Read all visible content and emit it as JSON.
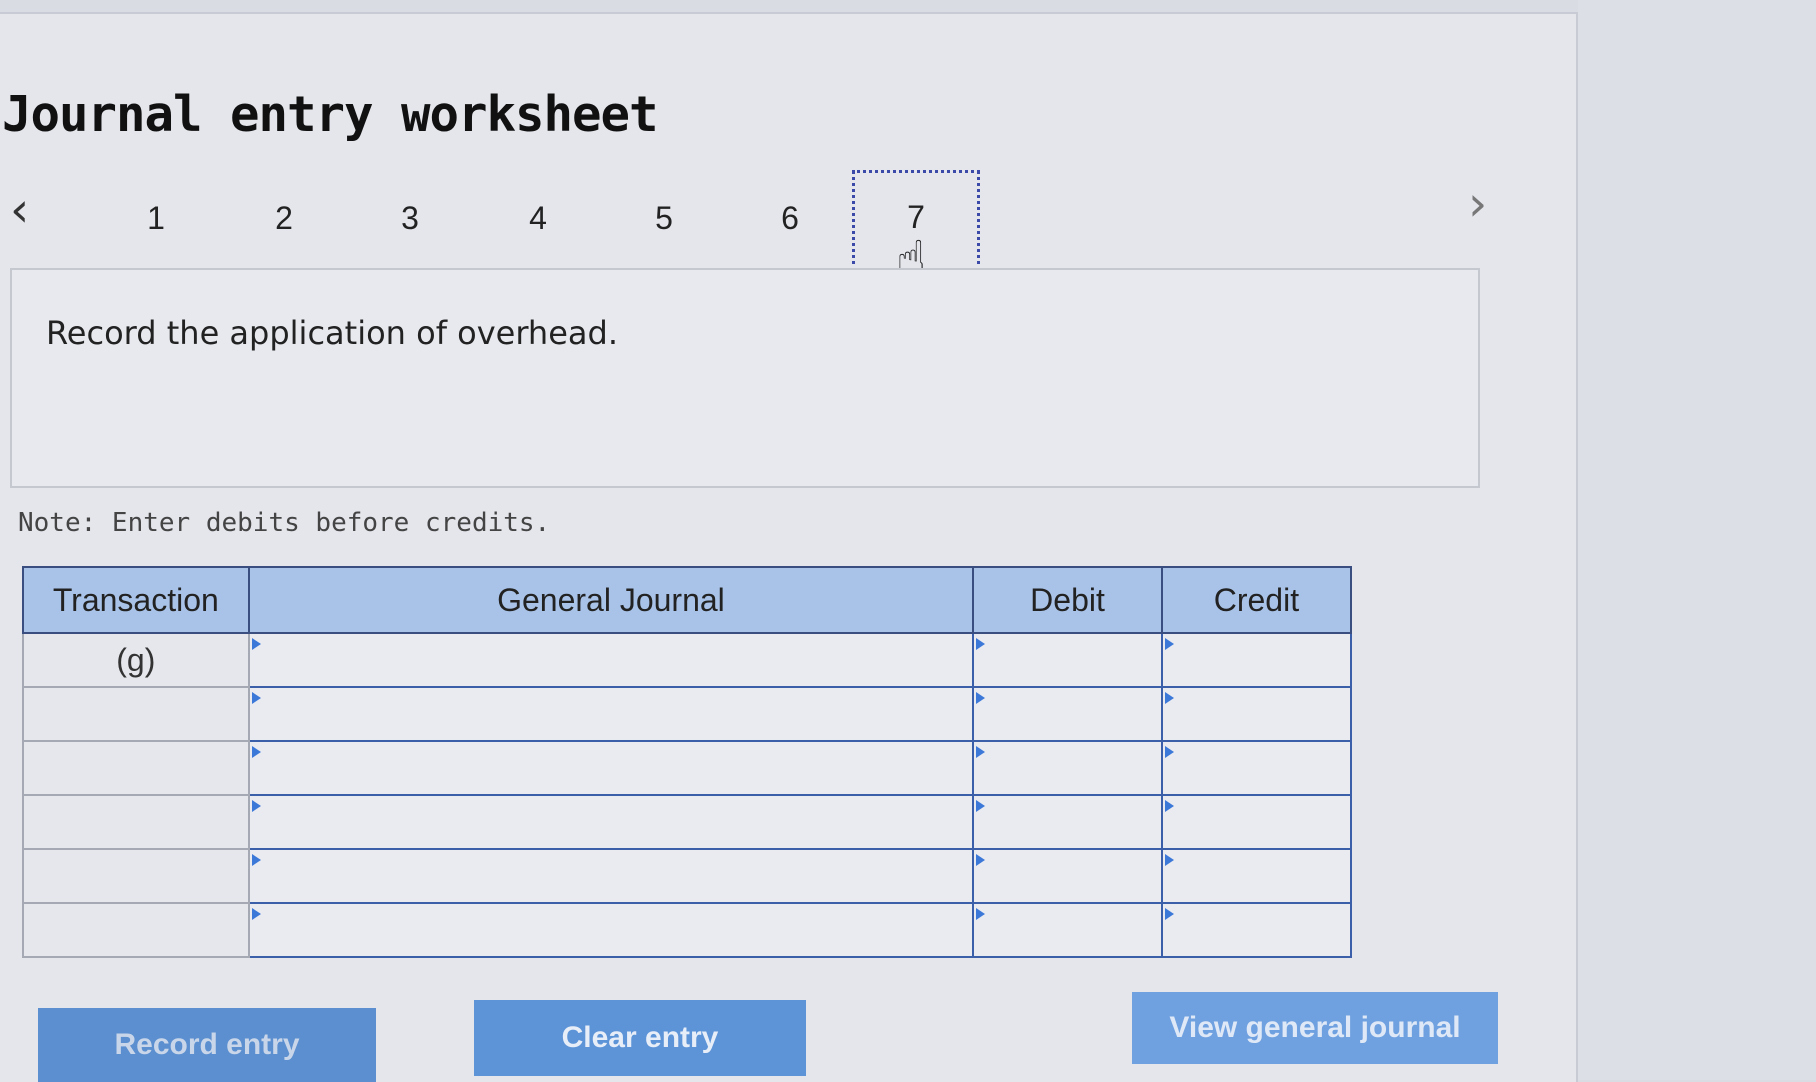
{
  "header": {
    "title": "Journal entry worksheet"
  },
  "pager": {
    "prev_icon": "chevron-left-icon",
    "next_icon": "chevron-right-icon",
    "pages": [
      "1",
      "2",
      "3",
      "4",
      "5",
      "6",
      "7"
    ],
    "active_page": "7"
  },
  "prompt": {
    "text": "Record the application of overhead."
  },
  "note": "Note: Enter debits before credits.",
  "table": {
    "headers": {
      "transaction": "Transaction",
      "general_journal": "General Journal",
      "debit": "Debit",
      "credit": "Credit"
    },
    "rows": [
      {
        "transaction": "(g)",
        "account": "",
        "debit": "",
        "credit": ""
      },
      {
        "transaction": "",
        "account": "",
        "debit": "",
        "credit": ""
      },
      {
        "transaction": "",
        "account": "",
        "debit": "",
        "credit": ""
      },
      {
        "transaction": "",
        "account": "",
        "debit": "",
        "credit": ""
      },
      {
        "transaction": "",
        "account": "",
        "debit": "",
        "credit": ""
      },
      {
        "transaction": "",
        "account": "",
        "debit": "",
        "credit": ""
      }
    ]
  },
  "buttons": {
    "record": "Record entry",
    "clear": "Clear entry",
    "view": "View general journal"
  },
  "colors": {
    "header_bg": "#a9c3e8",
    "button_bg": "#5a8fd0",
    "grid_border": "#3b5fa8"
  }
}
